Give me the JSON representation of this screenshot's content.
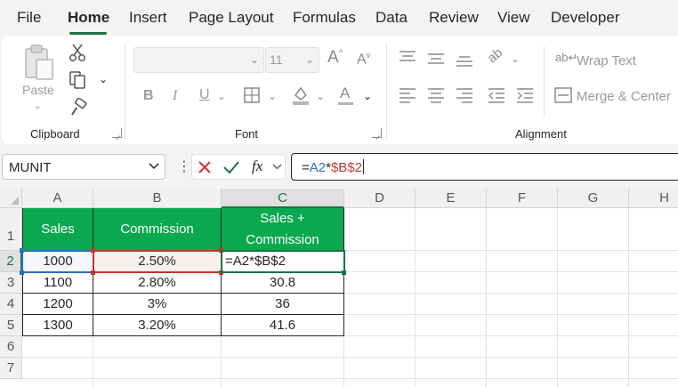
{
  "menu": {
    "tabs": [
      "File",
      "Home",
      "Insert",
      "Page Layout",
      "Formulas",
      "Data",
      "Review",
      "View",
      "Developer"
    ],
    "active": "Home"
  },
  "ribbon": {
    "clipboard": {
      "paste_label": "Paste",
      "group_label": "Clipboard"
    },
    "font": {
      "font_name": "",
      "font_size": "11",
      "bold": "B",
      "italic": "I",
      "underline": "U",
      "group_label": "Font"
    },
    "alignment": {
      "wrap_text": "Wrap Text",
      "merge_center": "Merge & Center",
      "group_label": "Alignment"
    }
  },
  "formula_bar": {
    "name_box": "MUNIT",
    "fx_label": "fx",
    "formula_eq": "=",
    "formula_ref1": "A2",
    "formula_op": "*",
    "formula_ref2": "$B$2"
  },
  "sheet": {
    "columns": [
      "A",
      "B",
      "C",
      "D",
      "E",
      "F",
      "G",
      "H"
    ],
    "rows": [
      "1",
      "2",
      "3",
      "4",
      "5",
      "6",
      "7"
    ],
    "headers": {
      "a": "Sales",
      "b": "Commission",
      "c": "Sales +\nCommission"
    },
    "data": [
      {
        "a": "1000",
        "b": "2.50%",
        "c": "=A2*$B$2"
      },
      {
        "a": "1100",
        "b": "2.80%",
        "c": "30.8"
      },
      {
        "a": "1200",
        "b": "3%",
        "c": "36"
      },
      {
        "a": "1300",
        "b": "3.20%",
        "c": "41.6"
      }
    ]
  },
  "colors": {
    "accent": "#1e7145",
    "table_header": "#0aa84f",
    "ref_blue": "#2b6cc4",
    "ref_red": "#c0392b"
  },
  "icons": [
    "cut-icon",
    "copy-icon",
    "format-painter-icon",
    "paste-icon",
    "grow-font-icon",
    "shrink-font-icon",
    "borders-icon",
    "fill-color-icon",
    "font-color-icon",
    "align-top-icon",
    "align-middle-icon",
    "align-bottom-icon",
    "orientation-icon",
    "align-left-icon",
    "align-center-icon",
    "align-right-icon",
    "decrease-indent-icon",
    "increase-indent-icon",
    "wrap-text-icon",
    "merge-center-icon",
    "cancel-icon",
    "enter-icon",
    "fx-icon",
    "chevron-down-icon"
  ]
}
